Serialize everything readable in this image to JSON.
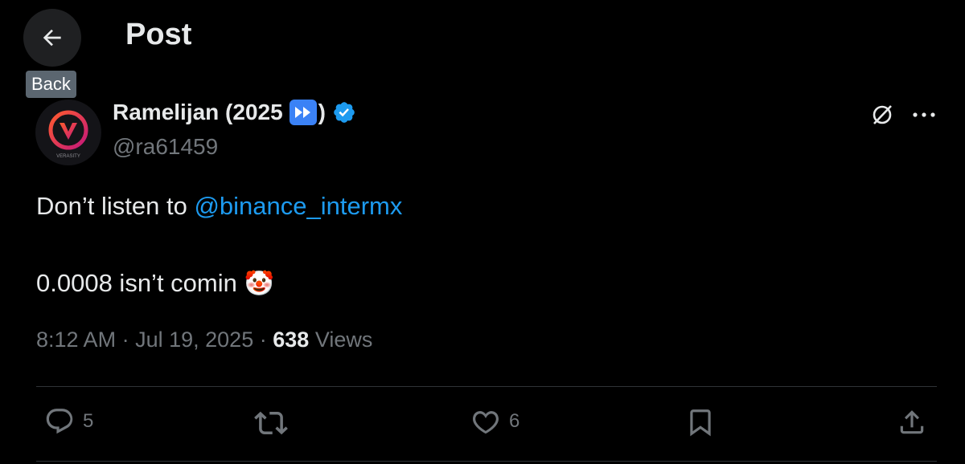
{
  "header": {
    "title": "Post",
    "back_tooltip": "Back"
  },
  "author": {
    "display_name": "Ramelijan (2025",
    "display_name_suffix": ")",
    "handle": "@ra61459",
    "avatar_text": "VERASITY",
    "verified": true
  },
  "post": {
    "line1_prefix": "Don’t listen to ",
    "mention": "@binance_intermx",
    "line2": "0.0008 isn’t comin",
    "emoji": "🤡"
  },
  "meta": {
    "time": "8:12 AM",
    "separator": "·",
    "date": "Jul 19, 2025",
    "views_count": "638",
    "views_label": "Views"
  },
  "actions": {
    "reply_count": "5",
    "like_count": "6"
  },
  "colors": {
    "background": "#000000",
    "accent": "#1d9bf0",
    "muted": "#71767b"
  }
}
